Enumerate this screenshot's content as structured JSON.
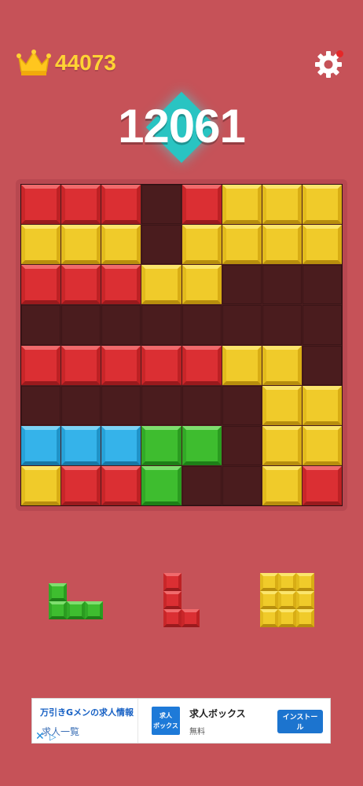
{
  "best_score": "44073",
  "current_score": "12061",
  "icons": {
    "best": "crown-icon",
    "settings": "gear-icon",
    "notification": "red-dot-badge"
  },
  "colors": {
    "background": "#c65258",
    "board_empty": "#4a1c1e",
    "red": "#db2f33",
    "yellow": "#f0cb2a",
    "blue": "#35b3ea",
    "green": "#3ebd2f",
    "score_accent": "#29c4c2",
    "best_score_text": "#ffd334"
  },
  "board": {
    "rows": 8,
    "cols": 8,
    "cells": [
      [
        "red",
        "red",
        "red",
        "",
        "red",
        "yellow",
        "yellow",
        "yellow"
      ],
      [
        "yellow",
        "yellow",
        "yellow",
        "",
        "yellow",
        "yellow",
        "yellow",
        "yellow"
      ],
      [
        "red",
        "red",
        "red",
        "yellow",
        "yellow",
        "",
        "",
        ""
      ],
      [
        "",
        "",
        "",
        "",
        "",
        "",
        "",
        ""
      ],
      [
        "red",
        "red",
        "red",
        "red",
        "red",
        "yellow",
        "yellow",
        ""
      ],
      [
        "",
        "",
        "",
        "",
        "",
        "",
        "yellow",
        "yellow"
      ],
      [
        "blue",
        "blue",
        "blue",
        "green",
        "green",
        "",
        "yellow",
        "yellow"
      ],
      [
        "yellow",
        "red",
        "red",
        "green",
        "",
        "",
        "yellow",
        "red"
      ]
    ]
  },
  "pieces": [
    {
      "color": "green",
      "shape": [
        [
          1,
          0,
          0
        ],
        [
          1,
          1,
          1
        ]
      ]
    },
    {
      "color": "red",
      "shape": [
        [
          1,
          0
        ],
        [
          1,
          0
        ],
        [
          1,
          1
        ]
      ]
    },
    {
      "color": "yellow",
      "shape": [
        [
          1,
          1,
          1
        ],
        [
          1,
          1,
          1
        ],
        [
          1,
          1,
          1
        ]
      ]
    }
  ],
  "ad": {
    "left_title": "万引きGメンの求人情報",
    "left_link": "求人一覧",
    "logo_text": "求人\nボックス",
    "title": "求人ボックス",
    "subtitle": "無料",
    "install_label": "インストール"
  }
}
